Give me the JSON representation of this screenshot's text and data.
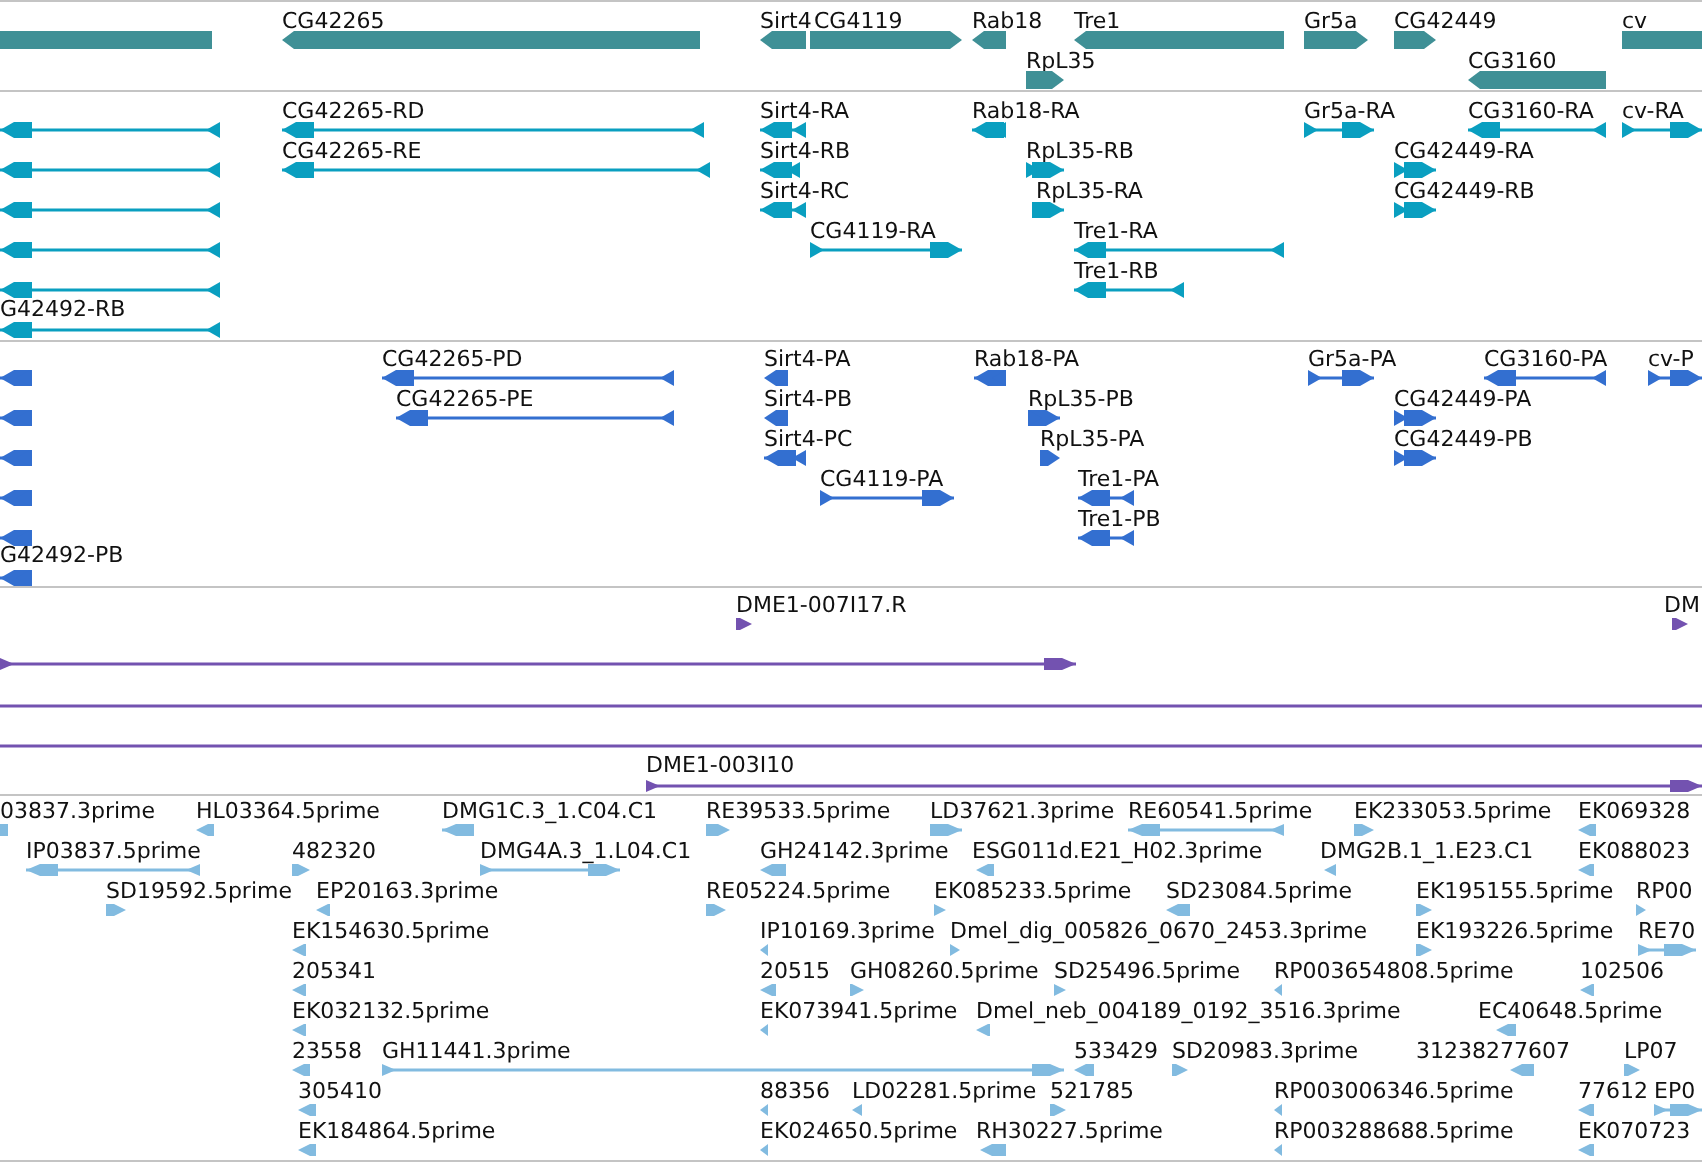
{
  "tracks": [
    {
      "kind": "gene",
      "color": "#3f9096",
      "features": [
        {
          "points_left": false,
          "points_right": false
        },
        {
          "label": "CG42265",
          "points_left": true,
          "points_right": false
        },
        {
          "label": "Sirt4",
          "points_left": true,
          "points_right": false
        },
        {
          "label": "CG4119",
          "points_left": false,
          "points_right": true
        },
        {
          "label": "Rab18",
          "points_left": true,
          "points_right": false
        },
        {
          "label": "Tre1",
          "points_left": true,
          "points_right": false
        },
        {
          "label": "Gr5a",
          "points_left": false,
          "points_right": true
        },
        {
          "label": "CG42449",
          "points_left": false,
          "points_right": true
        },
        {
          "label": "cv",
          "points_left": false,
          "points_right": false
        },
        {
          "label": "RpL35",
          "points_left": false,
          "points_right": true
        },
        {
          "label": "CG3160",
          "points_left": true,
          "points_right": false
        }
      ]
    },
    {
      "kind": "transcript",
      "color": "#0a9fc0",
      "features": [
        {
          "points_left": true,
          "points_right": false
        },
        {
          "points_left": true,
          "points_right": false
        },
        {
          "points_left": true,
          "points_right": false
        },
        {
          "points_left": true,
          "points_right": false
        },
        {
          "points_left": true,
          "points_right": false
        },
        {
          "label": "G42492-RB",
          "points_left": true,
          "points_right": false
        },
        {
          "label": "CG42265-RD",
          "points_left": true,
          "points_right": false
        },
        {
          "label": "Sirt4-RA",
          "points_left": true,
          "points_right": false
        },
        {
          "label": "Rab18-RA",
          "points_left": true,
          "points_right": false
        },
        {
          "label": "Gr5a-RA",
          "points_left": false,
          "points_right": true
        },
        {
          "label": "CG3160-RA",
          "points_left": true,
          "points_right": false
        },
        {
          "label": "cv-RA",
          "points_left": false,
          "points_right": true
        },
        {
          "label": "CG42265-RE",
          "points_left": true,
          "points_right": false
        },
        {
          "label": "Sirt4-RB",
          "points_left": true,
          "points_right": false
        },
        {
          "label": "RpL35-RB",
          "points_left": false,
          "points_right": true
        },
        {
          "label": "CG42449-RA",
          "points_left": false,
          "points_right": true
        },
        {
          "label": "Sirt4-RC",
          "points_left": true,
          "points_right": false
        },
        {
          "label": "RpL35-RA",
          "points_left": false,
          "points_right": true
        },
        {
          "label": "CG42449-RB",
          "points_left": false,
          "points_right": true
        },
        {
          "label": "CG4119-RA",
          "points_left": false,
          "points_right": true
        },
        {
          "label": "Tre1-RA",
          "points_left": true,
          "points_right": false
        },
        {
          "label": "Tre1-RB",
          "points_left": true,
          "points_right": false
        }
      ]
    },
    {
      "kind": "protein",
      "color": "#336fd0",
      "features": [
        {
          "points_left": true,
          "points_right": false
        },
        {
          "points_left": true,
          "points_right": false
        },
        {
          "points_left": true,
          "points_right": false
        },
        {
          "points_left": true,
          "points_right": false
        },
        {
          "points_left": true,
          "points_right": false
        },
        {
          "label": "G42492-PB",
          "points_left": true,
          "points_right": false
        },
        {
          "label": "CG42265-PD",
          "points_left": true,
          "points_right": false
        },
        {
          "label": "Sirt4-PA",
          "points_left": true,
          "points_right": false
        },
        {
          "label": "Rab18-PA",
          "points_left": true,
          "points_right": false
        },
        {
          "label": "Gr5a-PA",
          "points_left": false,
          "points_right": true
        },
        {
          "label": "CG3160-PA",
          "points_left": true,
          "points_right": false
        },
        {
          "label": "cv-P",
          "points_left": false,
          "points_right": true
        },
        {
          "label": "CG42265-PE",
          "points_left": true,
          "points_right": false
        },
        {
          "label": "Sirt4-PB",
          "points_left": true,
          "points_right": false
        },
        {
          "label": "RpL35-PB",
          "points_left": false,
          "points_right": true
        },
        {
          "label": "CG42449-PA",
          "points_left": false,
          "points_right": true
        },
        {
          "label": "Sirt4-PC",
          "points_left": true,
          "points_right": false
        },
        {
          "label": "RpL35-PA",
          "points_left": false,
          "points_right": true
        },
        {
          "label": "CG42449-PB",
          "points_left": false,
          "points_right": true
        },
        {
          "label": "CG4119-PA",
          "points_left": false,
          "points_right": true
        },
        {
          "label": "Tre1-PA",
          "points_left": true,
          "points_right": false
        },
        {
          "label": "Tre1-PB",
          "points_left": true,
          "points_right": false
        }
      ]
    },
    {
      "kind": "clone",
      "color": "#7352b0",
      "features": [
        {
          "label": "DME1-007I17.R",
          "points_left": false,
          "points_right": true
        },
        {
          "label": "DM",
          "points_left": false,
          "points_right": true
        },
        {
          "points_left": false,
          "points_right": true
        },
        {
          "points_left": false,
          "points_right": false
        },
        {
          "points_left": false,
          "points_right": false
        },
        {
          "label": "DME1-003I10",
          "points_left": false,
          "points_right": true
        }
      ]
    },
    {
      "kind": "est",
      "color": "#82bbe0",
      "features": [
        {
          "label": "03837.3prime",
          "points_left": false,
          "points_right": false
        },
        {
          "label": "HL03364.5prime",
          "points_left": true,
          "points_right": false
        },
        {
          "label": "DMG1C.3_1.C04.C1",
          "points_left": true,
          "points_right": false
        },
        {
          "label": "RE39533.5prime",
          "points_left": false,
          "points_right": true
        },
        {
          "label": "LD37621.3prime",
          "points_left": false,
          "points_right": true
        },
        {
          "label": "RE60541.5prime",
          "points_left": true,
          "points_right": false
        },
        {
          "label": "EK233053.5prime",
          "points_left": false,
          "points_right": true
        },
        {
          "label": "EK069328",
          "points_left": true,
          "points_right": false
        },
        {
          "label": "IP03837.5prime",
          "points_left": true,
          "points_right": false
        },
        {
          "label": "482320",
          "points_left": false,
          "points_right": true
        },
        {
          "label": "DMG4A.3_1.L04.C1",
          "points_left": false,
          "points_right": true
        },
        {
          "label": "GH24142.3prime",
          "points_left": true,
          "points_right": false
        },
        {
          "label": "ESG011d.E21_H02.3prime",
          "points_left": true,
          "points_right": false
        },
        {
          "label": "DMG2B.1_1.E23.C1",
          "points_left": true,
          "points_right": false
        },
        {
          "label": "EK088023",
          "points_left": true,
          "points_right": false
        },
        {
          "label": "SD19592.5prime",
          "points_left": false,
          "points_right": true
        },
        {
          "label": "EP20163.3prime",
          "points_left": true,
          "points_right": false
        },
        {
          "label": "RE05224.5prime",
          "points_left": false,
          "points_right": true
        },
        {
          "label": "EK085233.5prime",
          "points_left": false,
          "points_right": true
        },
        {
          "label": "SD23084.5prime",
          "points_left": true,
          "points_right": false
        },
        {
          "label": "EK195155.5prime",
          "points_left": false,
          "points_right": true
        },
        {
          "label": "RP00",
          "points_left": false,
          "points_right": true
        },
        {
          "label": "EK154630.5prime",
          "points_left": true,
          "points_right": false
        },
        {
          "label": "IP10169.3prime",
          "points_left": true,
          "points_right": false
        },
        {
          "label": "Dmel_dig_005826_0670_2453.3prime",
          "points_left": false,
          "points_right": true
        },
        {
          "label": "EK193226.5prime",
          "points_left": false,
          "points_right": true
        },
        {
          "label": "RE70",
          "points_left": false,
          "points_right": true
        },
        {
          "label": "205341",
          "points_left": true,
          "points_right": false
        },
        {
          "label": "20515",
          "points_left": true,
          "points_right": false
        },
        {
          "label": "GH08260.5prime",
          "points_left": false,
          "points_right": true
        },
        {
          "label": "SD25496.5prime",
          "points_left": false,
          "points_right": true
        },
        {
          "label": "RP003654808.5prime",
          "points_left": true,
          "points_right": false
        },
        {
          "label": "102506",
          "points_left": true,
          "points_right": false
        },
        {
          "label": "EK032132.5prime",
          "points_left": true,
          "points_right": false
        },
        {
          "label": "EK073941.5prime",
          "points_left": true,
          "points_right": false
        },
        {
          "label": "Dmel_neb_004189_0192_3516.3prime",
          "points_left": true,
          "points_right": false
        },
        {
          "label": "EC40648.5prime",
          "points_left": true,
          "points_right": false
        },
        {
          "label": "23558",
          "points_left": true,
          "points_right": false
        },
        {
          "label": "GH11441.3prime",
          "points_left": false,
          "points_right": true
        },
        {
          "label": "533429",
          "points_left": true,
          "points_right": false
        },
        {
          "label": "SD20983.3prime",
          "points_left": false,
          "points_right": true
        },
        {
          "label": "31238277607",
          "points_left": true,
          "points_right": false
        },
        {
          "label": "LP07",
          "points_left": false,
          "points_right": true
        },
        {
          "label": "305410",
          "points_left": true,
          "points_right": false
        },
        {
          "label": "88356",
          "points_left": true,
          "points_right": false
        },
        {
          "label": "LD02281.5prime",
          "points_left": true,
          "points_right": false
        },
        {
          "label": "521785",
          "points_left": false,
          "points_right": true
        },
        {
          "label": "RP003006346.5prime",
          "points_left": true,
          "points_right": false
        },
        {
          "label": "77612",
          "points_left": true,
          "points_right": false
        },
        {
          "label": "EP0",
          "points_left": false,
          "points_right": true
        },
        {
          "label": "EK184864.5prime",
          "points_left": true,
          "points_right": false
        },
        {
          "label": "EK024650.5prime",
          "points_left": true,
          "points_right": false
        },
        {
          "label": "RH30227.5prime",
          "points_left": true,
          "points_right": false
        },
        {
          "label": "RP003288688.5prime",
          "points_left": true,
          "points_right": false
        },
        {
          "label": "EK070723",
          "points_left": true,
          "points_right": false
        }
      ]
    }
  ]
}
